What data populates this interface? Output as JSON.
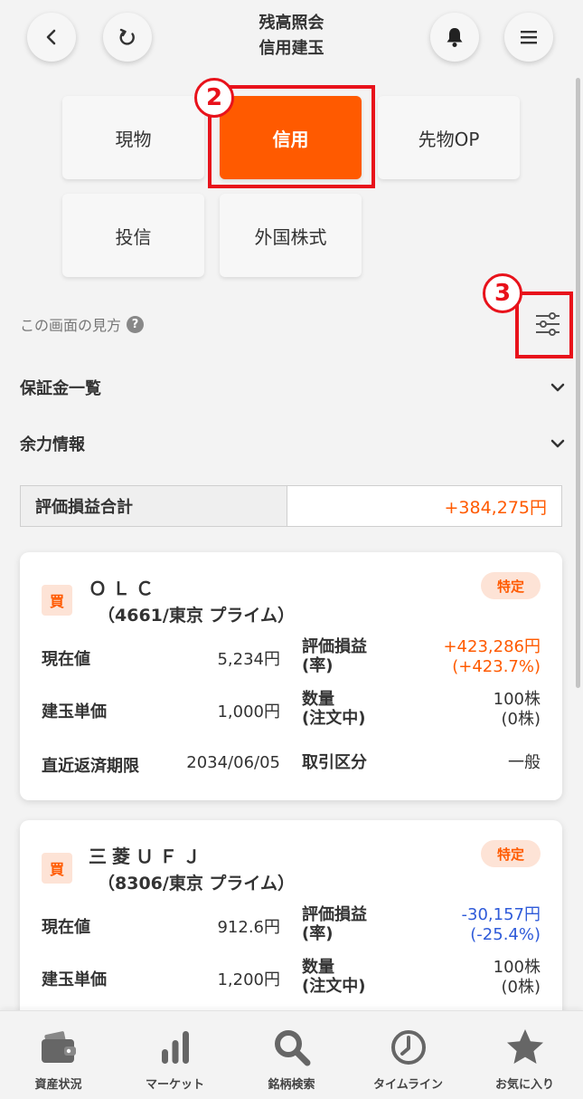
{
  "header": {
    "title_line1": "残高照会",
    "title_line2": "信用建玉",
    "back_icon": "chevron-left-icon",
    "refresh_icon": "refresh-icon",
    "bell_icon": "bell-icon",
    "menu_icon": "hamburger-menu-icon"
  },
  "tabs": [
    {
      "label": "現物",
      "active": false
    },
    {
      "label": "信用",
      "active": true
    },
    {
      "label": "先物OP",
      "active": false
    },
    {
      "label": "投信",
      "active": false
    },
    {
      "label": "外国株式",
      "active": false
    }
  ],
  "callouts": {
    "tab": "2",
    "filter": "3"
  },
  "howto": {
    "label": "この画面の見方",
    "icon": "help-icon",
    "glyph": "?"
  },
  "accordions": [
    {
      "label": "保証金一覧"
    },
    {
      "label": "余力情報"
    }
  ],
  "total": {
    "label": "評価損益合計",
    "value": "+384,275円"
  },
  "positions": [
    {
      "side": "買",
      "account": "特定",
      "name": "ＯＬＣ",
      "code": "（4661/東京 プライム）",
      "current_price_label": "現在値",
      "current_price": "5,234円",
      "pl_label_1": "評価損益",
      "pl_label_2": "(率)",
      "pl_value": "+423,286円",
      "pl_rate": "(+423.7%)",
      "pl_sign": "pos",
      "unit_price_label": "建玉単価",
      "unit_price": "1,000円",
      "qty_label_1": "数量",
      "qty_label_2": "(注文中)",
      "qty": "100株",
      "qty_pending": "(0株)",
      "deadline_label": "直近返済期限",
      "deadline": "2034/06/05",
      "trade_type_label": "取引区分",
      "trade_type": "一般"
    },
    {
      "side": "買",
      "account": "特定",
      "name": "三菱ＵＦＪ",
      "code": "（8306/東京 プライム）",
      "current_price_label": "現在値",
      "current_price": "912.6円",
      "pl_label_1": "評価損益",
      "pl_label_2": "(率)",
      "pl_value": "-30,157円",
      "pl_rate": "(-25.4%)",
      "pl_sign": "neg",
      "unit_price_label": "建玉単価",
      "unit_price": "1,200円",
      "qty_label_1": "数量",
      "qty_label_2": "(注文中)",
      "qty": "100株",
      "qty_pending": "(0株)"
    }
  ],
  "bottom_nav": [
    {
      "label": "資産状況",
      "icon": "wallet-icon"
    },
    {
      "label": "マーケット",
      "icon": "bar-chart-icon"
    },
    {
      "label": "銘柄検索",
      "icon": "search-icon"
    },
    {
      "label": "タイムライン",
      "icon": "clock-icon"
    },
    {
      "label": "お気に入り",
      "icon": "star-icon"
    }
  ],
  "colors": {
    "accent": "#ff5a00",
    "callout": "#e8121b",
    "negative": "#2f5bd9",
    "badge_bg": "#fde3d6"
  }
}
